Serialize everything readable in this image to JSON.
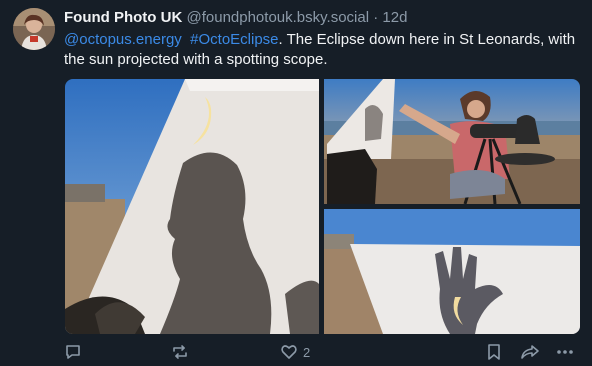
{
  "post": {
    "author_name": "Found Photo UK",
    "handle": "@foundphotouk.bsky.social",
    "separator": "·",
    "age": "12d",
    "mentions": [
      "@octopus.energy",
      "#OctoEclipse"
    ],
    "text": ". The Eclipse down here in St Leonards, with the sun projected with a spotting scope."
  },
  "actions": {
    "reply_icon": "reply-icon",
    "repost_icon": "repost-icon",
    "like_icon": "heart-icon",
    "like_count": "2",
    "bookmark_icon": "bookmark-icon",
    "share_icon": "share-icon",
    "more_icon": "more-icon"
  },
  "colors": {
    "background": "#161e27",
    "link": "#3b8ae6",
    "muted": "#8c9aa8"
  }
}
